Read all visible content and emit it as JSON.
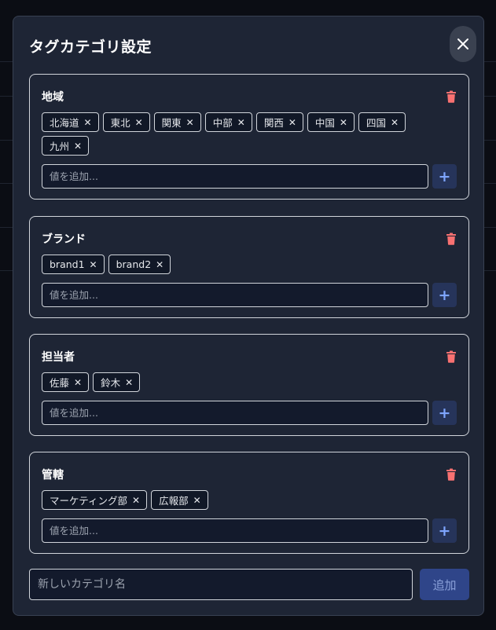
{
  "modal": {
    "title": "タグカテゴリ設定",
    "close_icon": "close-icon"
  },
  "categories": [
    {
      "name": "地域",
      "values": [
        "北海道",
        "東北",
        "関東",
        "中部",
        "関西",
        "中国",
        "四国",
        "九州"
      ],
      "input_placeholder": "値を追加...",
      "add_label": "+"
    },
    {
      "name": "ブランド",
      "values": [
        "brand1",
        "brand2"
      ],
      "input_placeholder": "値を追加...",
      "add_label": "+"
    },
    {
      "name": "担当者",
      "values": [
        "佐藤",
        "鈴木"
      ],
      "input_placeholder": "値を追加...",
      "add_label": "+"
    },
    {
      "name": "管轄",
      "values": [
        "マーケティング部",
        "広報部"
      ],
      "input_placeholder": "値を追加...",
      "add_label": "+"
    }
  ],
  "new_category": {
    "placeholder": "新しいカテゴリ名",
    "add_label": "追加"
  },
  "remove_glyph": "✕",
  "colors": {
    "delete_icon": "#f87171",
    "accent": "#2f4589",
    "plus": "#7fa6ff"
  }
}
